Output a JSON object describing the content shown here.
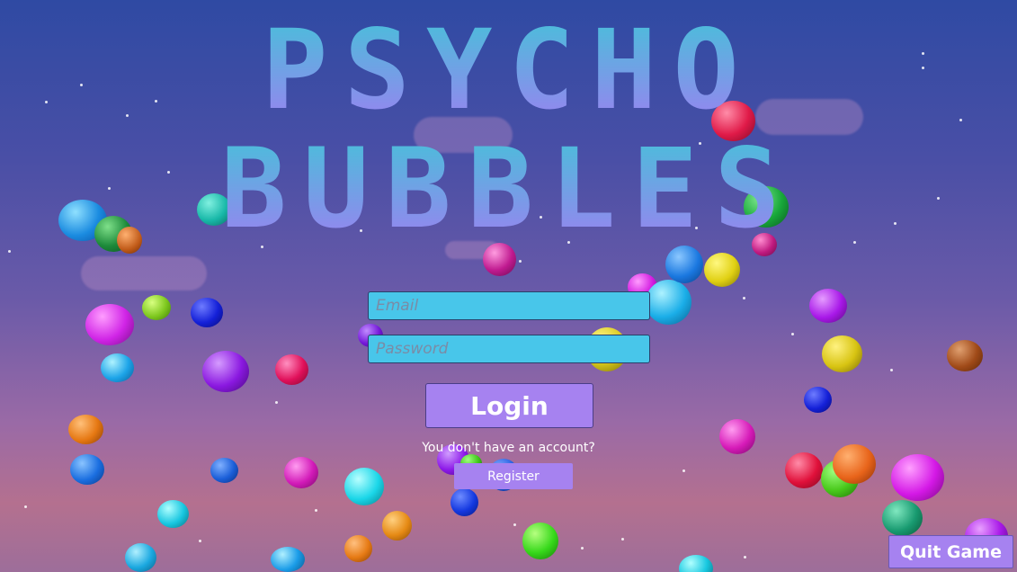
{
  "game": {
    "title_line1": "PSYCHO",
    "title_line2": "BUBBLES"
  },
  "login_form": {
    "email_placeholder": "Email",
    "password_placeholder": "Password",
    "login_label": "Login",
    "no_account_text": "You don't have an account?",
    "register_label": "Register"
  },
  "quit_label": "Quit Game",
  "colors": {
    "accent": "#a682f0",
    "input_bg": "#48c6ea",
    "title_top": "#42c4d8",
    "title_bottom": "#9f7ef2"
  }
}
